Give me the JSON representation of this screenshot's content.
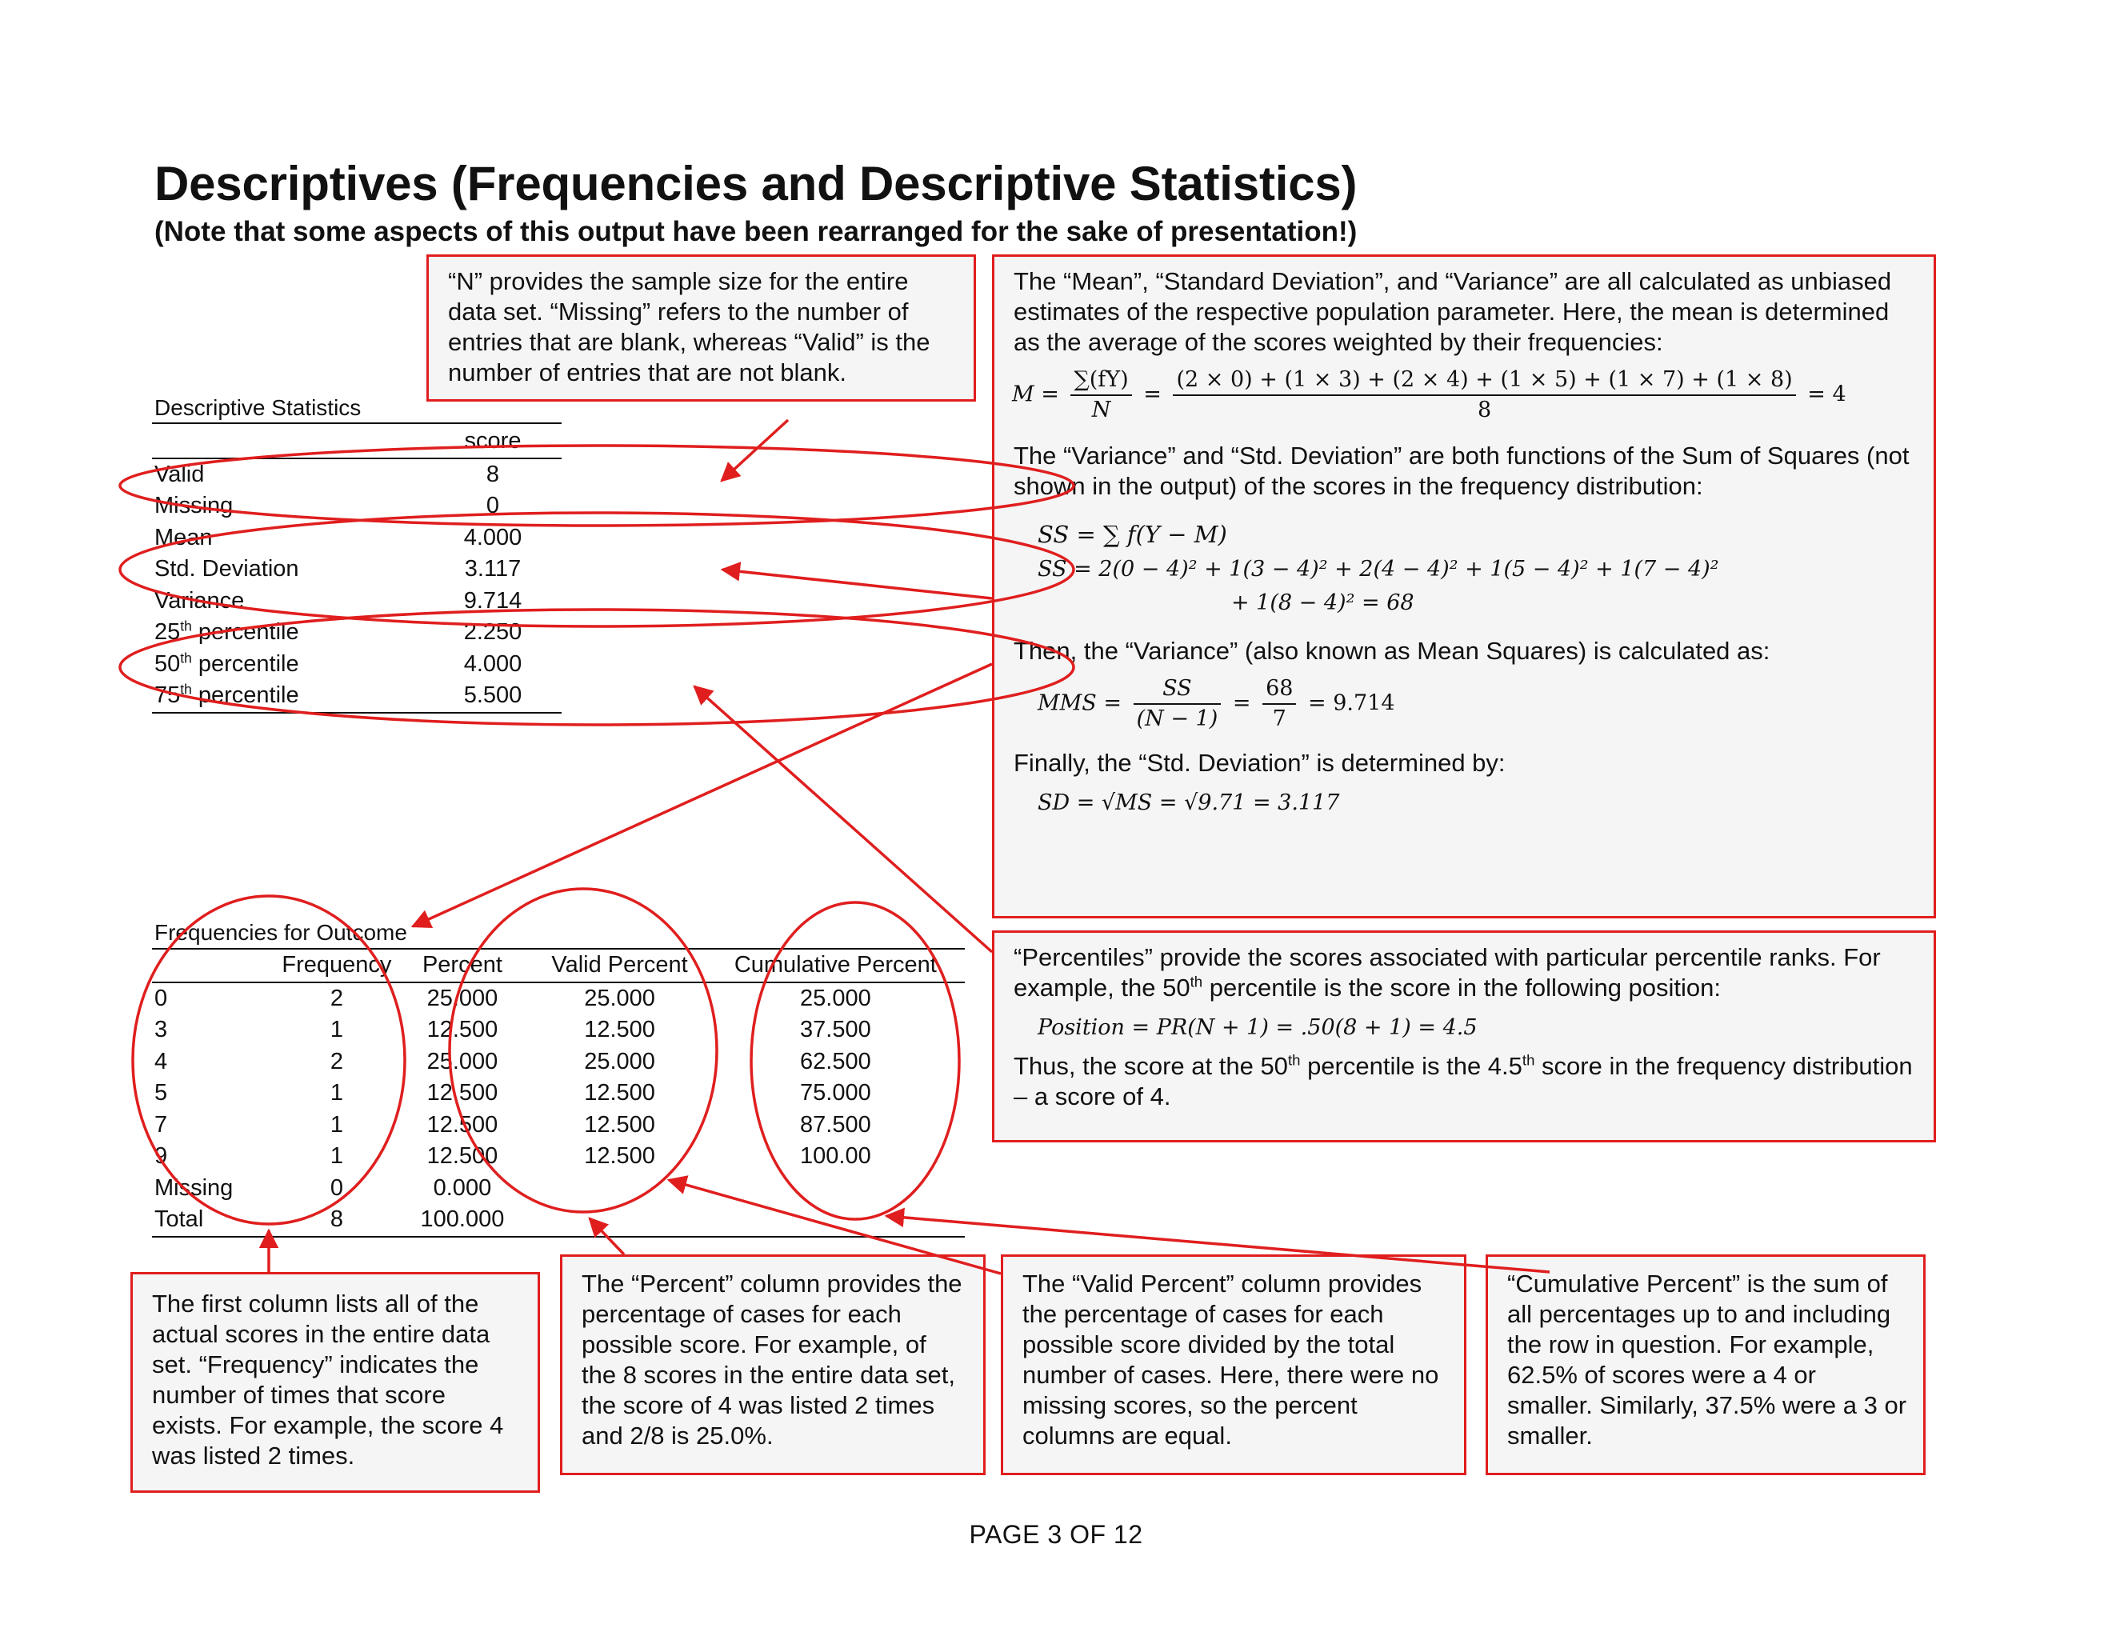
{
  "header": {
    "title": "Descriptives (Frequencies and Descriptive Statistics)",
    "subtitle": "(Note that some aspects of this output have been rearranged for the sake of presentation!)"
  },
  "descriptive_table": {
    "caption": "Descriptive Statistics",
    "column_header": "score",
    "rows": [
      {
        "label": "Valid",
        "value": "8"
      },
      {
        "label": "Missing",
        "value": "0"
      },
      {
        "label": "Mean",
        "value": "4.000"
      },
      {
        "label": "Std. Deviation",
        "value": "3.117"
      },
      {
        "label": "Variance",
        "value": "9.714"
      },
      {
        "label": "25",
        "sup": "th",
        "label_rest": " percentile",
        "value": "2.250"
      },
      {
        "label": "50",
        "sup": "th",
        "label_rest": " percentile",
        "value": "4.000"
      },
      {
        "label": "75",
        "sup": "th",
        "label_rest": " percentile",
        "value": "5.500"
      }
    ]
  },
  "frequency_table": {
    "caption": "Frequencies for Outcome",
    "headers": [
      "",
      "Frequency",
      "Percent",
      "Valid Percent",
      "Cumulative Percent"
    ],
    "rows": [
      [
        "0",
        "2",
        "25.000",
        "25.000",
        "25.000"
      ],
      [
        "3",
        "1",
        "12.500",
        "12.500",
        "37.500"
      ],
      [
        "4",
        "2",
        "25.000",
        "25.000",
        "62.500"
      ],
      [
        "5",
        "1",
        "12.500",
        "12.500",
        "75.000"
      ],
      [
        "7",
        "1",
        "12.500",
        "12.500",
        "87.500"
      ],
      [
        "9",
        "1",
        "12.500",
        "12.500",
        "100.00"
      ],
      [
        "Missing",
        "0",
        "0.000",
        "",
        ""
      ],
      [
        "Total",
        "8",
        "100.000",
        "",
        ""
      ]
    ]
  },
  "annotations": {
    "n_note": "“N” provides the sample size for the entire data set. “Missing” refers to the number of entries that are blank, whereas “Valid” is the number of entries that are not blank.",
    "mean_intro": "The “Mean”, “Standard Deviation”, and “Variance” are all calculated as unbiased estimates of the respective population parameter. Here, the mean is determined as the average of the scores weighted by their frequencies:",
    "mean_formula": {
      "lhs": "M =",
      "num1": "∑(fY)",
      "den1": "N",
      "eq": "=",
      "num2": "(2 × 0) + (1 × 3) + (2 × 4) + (1 × 5) + (1 × 7) + (1  × 8)",
      "den2": "8",
      "result": "= 4"
    },
    "ss_intro": "The “Variance” and “Std. Deviation” are both functions of the Sum of Squares (not shown in the output) of the scores in the frequency distribution:",
    "ss_formula_1": "SS = ∑ f(Y − M)",
    "ss_formula_2a": "SS = 2(0 − 4)² + 1(3 − 4)² + 2(4 − 4)² + 1(5 − 4)² + 1(7 − 4)²",
    "ss_formula_2b": "+ 1(8 − 4)² = 68",
    "variance_intro": "Then, the “Variance” (also known as Mean Squares) is calculated as:",
    "variance_formula": {
      "lhs": "MMS =",
      "num1": "SS",
      "den1": "(N − 1)",
      "eq": "=",
      "num2": "68",
      "den2": "7",
      "result": "= 9.714"
    },
    "sd_intro": "Finally, the “Std. Deviation” is determined by:",
    "sd_formula": "SD = √MS = √9.71 = 3.117",
    "percentile_note_1": "“Percentiles” provide the scores associated with particular percentile ranks. For example, the 50",
    "percentile_note_1_sup": "th",
    "percentile_note_1_rest": " percentile is the score in the following position:",
    "percentile_formula": "Position = PR(N + 1) = .50(8 + 1) = 4.5",
    "percentile_note_2a": "Thus, the score at the 50",
    "percentile_note_2_sup1": "th",
    "percentile_note_2b": " percentile is the 4.5",
    "percentile_note_2_sup2": "th",
    "percentile_note_2c": " score in the frequency distribution – a score of 4.",
    "first_column_note": "The first column lists all of the actual scores in the entire data set. “Frequency” indicates the number of times that score exists. For example, the score 4 was listed 2 times.",
    "percent_note": "The “Percent” column provides the percentage of cases for each possible score. For example, of the 8 scores in the entire data set, the score of 4 was listed 2 times and 2/8 is 25.0%.",
    "valid_percent_note": "The “Valid Percent” column provides the percentage of cases for each possible score divided by the total number of cases. Here, there were no missing scores, so the percent columns are equal.",
    "cumulative_note": "“Cumulative Percent” is the sum of all percentages up to and including the row in question. For example, 62.5% of scores were a 4 or smaller. Similarly, 37.5% were a 3 or smaller."
  },
  "footer": {
    "page": "PAGE 3 OF 12"
  },
  "colors": {
    "annotation_red": "#e01e1e",
    "box_fill": "#f5f5f5"
  }
}
